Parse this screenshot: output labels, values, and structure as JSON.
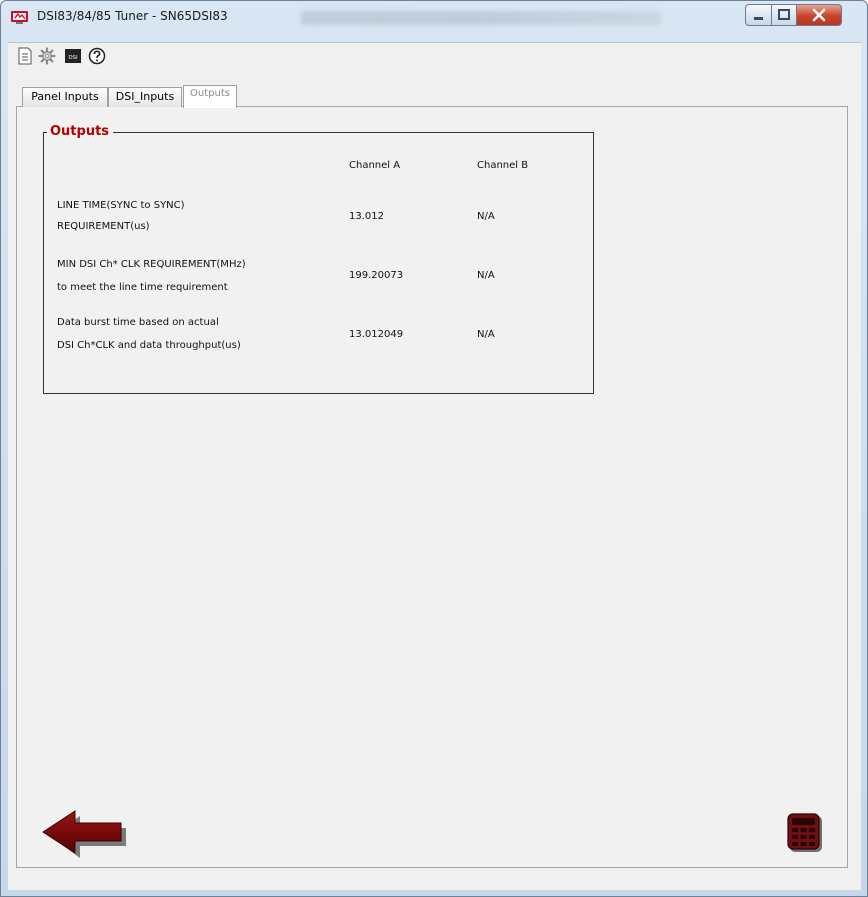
{
  "window": {
    "title": "DSI83/84/85 Tuner - SN65DSI83"
  },
  "toolbar": {
    "icons": [
      "document-icon",
      "gear-icon",
      "dsi-icon",
      "help-icon"
    ],
    "dsi_icon_text": "DSI"
  },
  "tabs": [
    {
      "label": "Panel Inputs"
    },
    {
      "label": "DSI_Inputs"
    },
    {
      "label": "Outputs",
      "selected": true
    }
  ],
  "outputs": {
    "group_title": "Outputs",
    "columns": [
      "Channel A",
      "Channel B"
    ],
    "rows": [
      {
        "label_line1": "LINE TIME(SYNC to SYNC)",
        "label_line2": "REQUIREMENT(us)",
        "channel_a": "13.012",
        "channel_b": "N/A"
      },
      {
        "label_line1": "MIN DSI Ch* CLK REQUIREMENT(MHz)",
        "label_line2": "to meet the line time requirement",
        "channel_a": "199.20073",
        "channel_b": "N/A"
      },
      {
        "label_line1": "Data burst time based on actual",
        "label_line2": "DSI Ch*CLK and data throughput(us)",
        "channel_a": "13.012049",
        "channel_b": "N/A"
      }
    ]
  },
  "colors": {
    "accent": "#b00000",
    "arrow": "#7a0a0a",
    "calculator": "#6e0f12"
  },
  "footer": {
    "icons": [
      "back-arrow-icon",
      "calculator-icon"
    ]
  }
}
